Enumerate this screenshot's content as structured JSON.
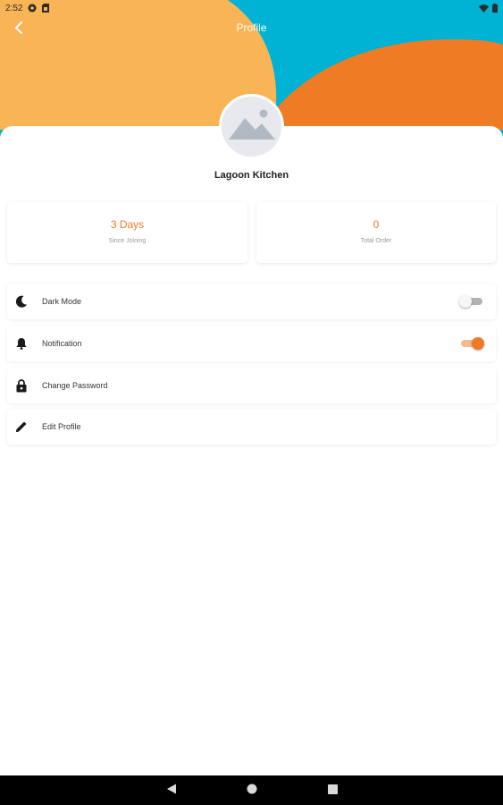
{
  "status_bar": {
    "time": "2:52",
    "left_icons": [
      "settings-icon",
      "sim-card-icon"
    ],
    "right_icons": [
      "wifi-icon",
      "battery-icon"
    ]
  },
  "appbar": {
    "title": "Profile",
    "back_icon": "chevron-left-icon"
  },
  "colors": {
    "accent": "#f07a26",
    "header_yellow": "#f9b455",
    "header_teal": "#00b2d3",
    "header_orange": "#ef7b24"
  },
  "profile": {
    "name": "Lagoon Kitchen",
    "avatar_icon": "image-placeholder-icon"
  },
  "stats": [
    {
      "value": "3 Days",
      "label": "Since Joining"
    },
    {
      "value": "0",
      "label": "Total Order"
    }
  ],
  "settings": [
    {
      "label": "Dark Mode",
      "icon": "moon-icon",
      "toggle": false
    },
    {
      "label": "Notification",
      "icon": "bell-icon",
      "toggle": true
    },
    {
      "label": "Change Password",
      "icon": "lock-icon"
    },
    {
      "label": "Edit Profile",
      "icon": "pencil-icon"
    }
  ],
  "nav_bar": {
    "buttons": [
      "back-triangle-icon",
      "home-circle-icon",
      "recents-square-icon"
    ]
  }
}
